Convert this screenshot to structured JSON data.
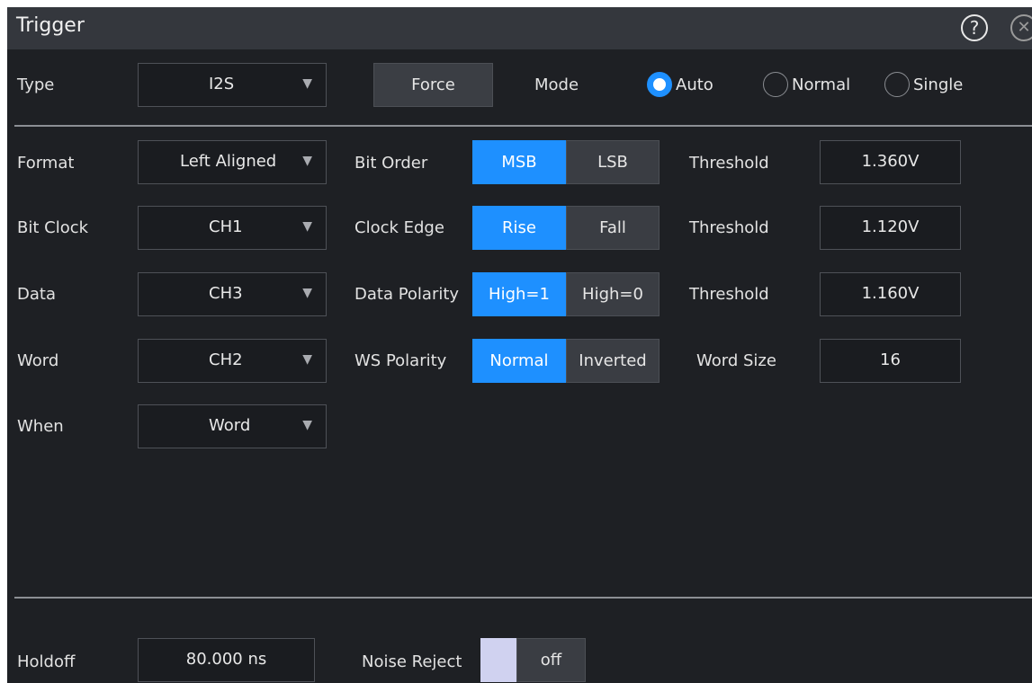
{
  "dialog": {
    "title": "Trigger"
  },
  "type": {
    "label": "Type",
    "value": "I2S"
  },
  "force_label": "Force",
  "mode": {
    "label": "Mode",
    "options": [
      {
        "label": "Auto",
        "selected": true
      },
      {
        "label": "Normal",
        "selected": false
      },
      {
        "label": "Single",
        "selected": false
      }
    ]
  },
  "format": {
    "label": "Format",
    "value": "Left Aligned"
  },
  "bit_clock": {
    "label": "Bit Clock",
    "value": "CH1"
  },
  "data": {
    "label": "Data",
    "value": "CH3"
  },
  "word": {
    "label": "Word",
    "value": "CH2"
  },
  "when": {
    "label": "When",
    "value": "Word"
  },
  "bit_order": {
    "label": "Bit Order",
    "options": [
      "MSB",
      "LSB"
    ],
    "selected": "MSB"
  },
  "clock_edge": {
    "label": "Clock Edge",
    "options": [
      "Rise",
      "Fall"
    ],
    "selected": "Rise"
  },
  "data_polarity": {
    "label": "Data Polarity",
    "options": [
      "High=1",
      "High=0"
    ],
    "selected": "High=1"
  },
  "ws_polarity": {
    "label": "WS Polarity",
    "options": [
      "Normal",
      "Inverted"
    ],
    "selected": "Normal"
  },
  "thresholds": [
    {
      "label": "Threshold",
      "value": "1.360V"
    },
    {
      "label": "Threshold",
      "value": "1.120V"
    },
    {
      "label": "Threshold",
      "value": "1.160V"
    }
  ],
  "word_size": {
    "label": "Word Size",
    "value": "16"
  },
  "holdoff": {
    "label": "Holdoff",
    "value": "80.000 ns"
  },
  "noise_reject": {
    "label": "Noise Reject",
    "state": "off"
  },
  "colors": {
    "accent": "#1e90ff",
    "background": "#1e2024",
    "titlebar": "#34373d"
  }
}
